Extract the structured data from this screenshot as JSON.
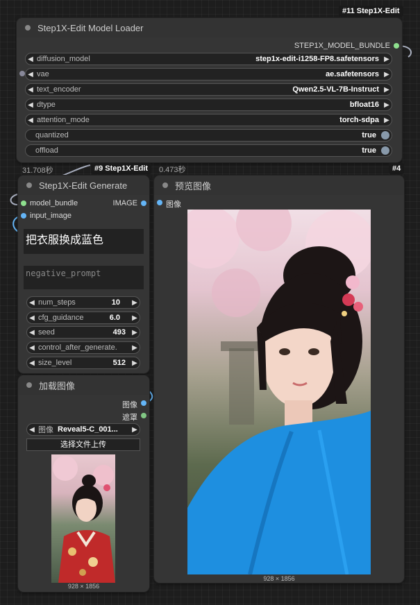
{
  "loader": {
    "badge": "#11 Step1X-Edit",
    "title": "Step1X-Edit Model Loader",
    "output_label": "STEP1X_MODEL_BUNDLE",
    "time": "31.708秒",
    "widgets": [
      {
        "label": "diffusion_model",
        "value": "step1x-edit-i1258-FP8.safetensors"
      },
      {
        "label": "vae",
        "value": "ae.safetensors"
      },
      {
        "label": "text_encoder",
        "value": "Qwen2.5-VL-7B-Instruct"
      },
      {
        "label": "dtype",
        "value": "bfloat16"
      },
      {
        "label": "attention_mode",
        "value": "torch-sdpa"
      },
      {
        "label": "quantized",
        "value": "true"
      },
      {
        "label": "offload",
        "value": "true"
      }
    ]
  },
  "generate": {
    "badge": "#9 Step1X-Edit",
    "title": "Step1X-Edit Generate",
    "inputs": [
      "model_bundle",
      "input_image"
    ],
    "output_label": "IMAGE",
    "prompt": "把衣服换成蓝色",
    "negative_placeholder": "negative_prompt",
    "widgets": [
      {
        "label": "num_steps",
        "value": "10"
      },
      {
        "label": "cfg_guidance",
        "value": "6.0"
      },
      {
        "label": "seed",
        "value": "493"
      },
      {
        "label": "control_after_generate.",
        "value": ""
      },
      {
        "label": "size_level",
        "value": "512"
      }
    ]
  },
  "preview": {
    "time": "0.473秒",
    "badge": "#4",
    "title": "预览图像",
    "input_label": "图像",
    "image_size": "928 × 1856"
  },
  "load_image": {
    "title": "加载图像",
    "outputs": [
      "图像",
      "遮罩"
    ],
    "image_widget_label": "图像",
    "image_widget_value": "Reveal5-C_001...",
    "upload_button": "选择文件上传",
    "image_size": "928 × 1856"
  },
  "colors": {
    "model_socket": "#8ee08e",
    "image_socket": "#64b5f6",
    "mask_socket": "#81c784",
    "vae_socket": "#888899",
    "link_color": "#aab0c0"
  }
}
